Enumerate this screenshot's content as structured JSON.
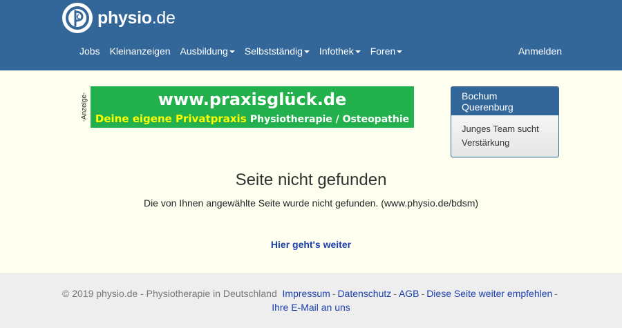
{
  "header": {
    "logo": {
      "bold": "physio",
      "rest": ".de"
    },
    "nav": [
      {
        "label": "Jobs",
        "dropdown": false
      },
      {
        "label": "Kleinanzeigen",
        "dropdown": false
      },
      {
        "label": "Ausbildung",
        "dropdown": true
      },
      {
        "label": "Selbstständig",
        "dropdown": true
      },
      {
        "label": "Infothek",
        "dropdown": true
      },
      {
        "label": "Foren",
        "dropdown": true
      }
    ],
    "login_label": "Anmelden"
  },
  "ad": {
    "label": "-Anzeige-",
    "url_text": "www.praxisglück.de",
    "tagline_highlight": "Deine eigene Privatpraxis",
    "tagline_rest": "Physiotherapie / Osteopathie"
  },
  "sidebox": {
    "title": "Bochum Querenburg",
    "text": "Junges Team sucht Verstärkung"
  },
  "main": {
    "title": "Seite nicht gefunden",
    "message": "Die von Ihnen angewählte Seite wurde nicht gefunden. (www.physio.de/bdsm)",
    "continue_label": "Hier geht's weiter"
  },
  "footer": {
    "copyright": "© 2019 physio.de - Physiotherapie in Deutschland",
    "links": [
      "Impressum",
      "Datenschutz",
      "AGB",
      "Diese Seite weiter empfehlen",
      "Ihre E-Mail an uns"
    ],
    "separator": "-"
  },
  "colors": {
    "header_bg": "#336699",
    "page_bg": "#fffff0",
    "ad_green": "#22b14c",
    "link": "#1a3fb0",
    "footer_bg": "#eeeeee"
  }
}
